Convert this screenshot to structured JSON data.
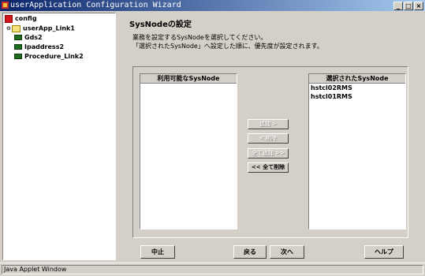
{
  "window": {
    "title": "userApplication Configuration Wizard",
    "buttons": [
      "_",
      "□",
      "×"
    ]
  },
  "tree": {
    "root": "config",
    "app": "userApp_Link1",
    "resources": [
      "Gds2",
      "Ipaddress2",
      "Procedure_Link2"
    ]
  },
  "page": {
    "heading": "SysNodeの設定",
    "desc1": "業務を設定するSysNodeを選択してください。",
    "desc2": "「選択されたSysNode」へ設定した順に、優先度が設定されます。"
  },
  "available": {
    "header": "利用可能なSysNode",
    "items": []
  },
  "selected": {
    "header": "選択されたSysNode",
    "items": [
      "hstcl02RMS",
      "hstcl01RMS"
    ]
  },
  "move_buttons": {
    "add": "追加 >",
    "remove": "< 削除",
    "add_all": "全て追加 >>",
    "remove_all": "<< 全て削除"
  },
  "nav_buttons": {
    "cancel": "中止",
    "back": "戻る",
    "next": "次へ",
    "help": "ヘルプ"
  },
  "status": "Java Applet Window"
}
